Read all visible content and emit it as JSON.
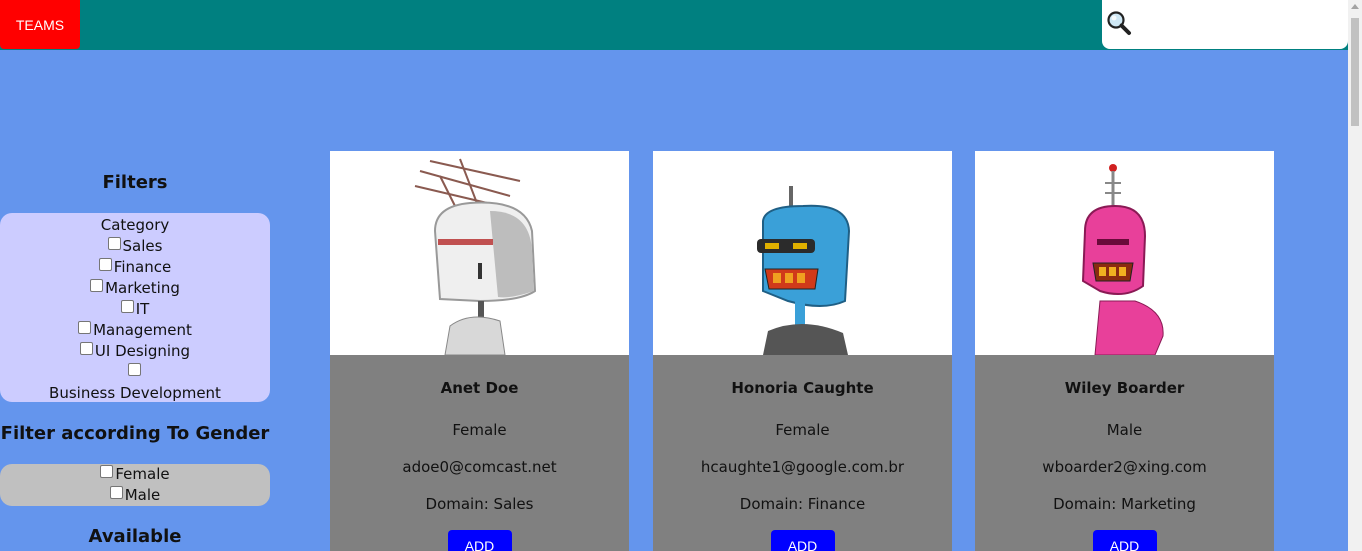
{
  "header": {
    "teams_label": "TEAMS",
    "search_placeholder": ""
  },
  "sidebar": {
    "filters_title": "Filters",
    "category_title": "Category",
    "categories": [
      "Sales",
      "Finance",
      "Marketing",
      "IT",
      "Management",
      "UI Designing",
      "Business Development"
    ],
    "gender_title": "Filter according To Gender",
    "genders": [
      "Female",
      "Male"
    ],
    "available_title": "Available"
  },
  "cards": [
    {
      "name": "Anet Doe",
      "gender": "Female",
      "email": "adoe0@comcast.net",
      "domain": "Domain: Sales",
      "add_label": "ADD",
      "avatar_color": "#e8e8e8"
    },
    {
      "name": "Honoria Caughte",
      "gender": "Female",
      "email": "hcaughte1@google.com.br",
      "domain": "Domain: Finance",
      "add_label": "ADD",
      "avatar_color": "#3aa0d8"
    },
    {
      "name": "Wiley Boarder",
      "gender": "Male",
      "email": "wboarder2@xing.com",
      "domain": "Domain: Marketing",
      "add_label": "ADD",
      "avatar_color": "#e8409a"
    }
  ],
  "colors": {
    "topbar": "#008080",
    "background": "#6495ed",
    "teams_button": "#ff0000",
    "add_button": "#0000ff",
    "card_body": "#808080"
  }
}
